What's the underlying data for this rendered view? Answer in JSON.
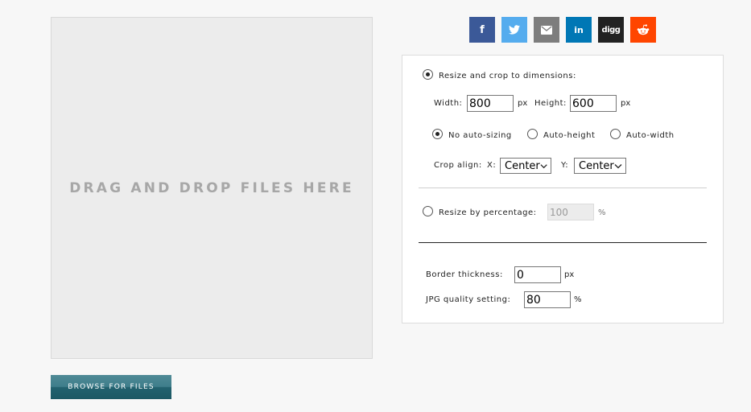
{
  "dropzone": {
    "text": "DRAG AND DROP FILES HERE"
  },
  "browse": {
    "label": "BROWSE FOR FILES"
  },
  "share": {
    "buttons": [
      {
        "name": "facebook",
        "glyph": "f",
        "color": "#3b5998"
      },
      {
        "name": "twitter",
        "icon": "twitter-bird-icon",
        "color": "#55acee"
      },
      {
        "name": "email",
        "icon": "envelope-icon",
        "color": "#7d7d7d"
      },
      {
        "name": "linkedin",
        "glyph": "in",
        "color": "#0077b5"
      },
      {
        "name": "digg",
        "glyph": "digg",
        "color": "#222222"
      },
      {
        "name": "reddit",
        "icon": "reddit-alien-icon",
        "color": "#ff4500"
      }
    ]
  },
  "options": {
    "resize_crop": {
      "label": "Resize and crop to dimensions:",
      "selected": true
    },
    "width": {
      "label": "Width:",
      "value": "800",
      "unit": "px"
    },
    "height": {
      "label": "Height:",
      "value": "600",
      "unit": "px"
    },
    "sizing": {
      "no_auto": {
        "label": "No auto-sizing",
        "selected": true
      },
      "auto_height": {
        "label": "Auto-height",
        "selected": false
      },
      "auto_width": {
        "label": "Auto-width",
        "selected": false
      }
    },
    "crop_align": {
      "label": "Crop align:",
      "x_label": "X:",
      "x_value": "Center",
      "y_label": "Y:",
      "y_value": "Center"
    },
    "resize_percent": {
      "label": "Resize by percentage:",
      "value": "100",
      "unit": "%",
      "selected": false
    },
    "border": {
      "label": "Border thickness:",
      "value": "0",
      "unit": "px"
    },
    "jpg_quality": {
      "label": "JPG quality setting:",
      "value": "80",
      "unit": "%"
    }
  }
}
